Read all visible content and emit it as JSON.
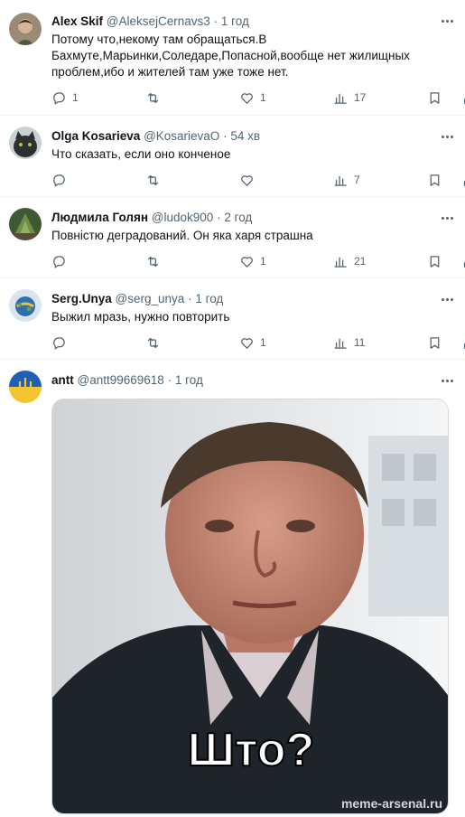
{
  "tweets": [
    {
      "name": "Alex Skif",
      "handle": "@AleksejCernavs3",
      "dot": "·",
      "time": "1 год",
      "text": "Потому что,некому там обращаться.В Бахмуте,Марьинки,Соледаре,Попасной,вообще нет жилищных проблем,ибо и жителей там уже тоже нет.",
      "replies": "1",
      "retweets": "",
      "likes": "1",
      "views": "17"
    },
    {
      "name": "Olga Kosarieva",
      "handle": "@KosarievaO",
      "dot": "·",
      "time": "54 хв",
      "text": "Что сказать, если оно конченое",
      "replies": "",
      "retweets": "",
      "likes": "",
      "views": "7"
    },
    {
      "name": "Людмила Голян",
      "handle": "@ludok900",
      "dot": "·",
      "time": "2 год",
      "text": "Повністю деградований. Он яка харя страшна",
      "replies": "",
      "retweets": "",
      "likes": "1",
      "views": "21"
    },
    {
      "name": "Serg.Unya",
      "handle": "@serg_unya",
      "dot": "·",
      "time": "1 год",
      "text": "Выжил мразь, нужно повторить",
      "replies": "",
      "retweets": "",
      "likes": "1",
      "views": "11"
    },
    {
      "name": "antt",
      "handle": "@antt99669618",
      "dot": "·",
      "time": "1 год"
    }
  ],
  "meme": {
    "caption": "Што?",
    "watermark": "meme-arsenal.ru"
  },
  "colors": {
    "text": "#0f1419",
    "secondary": "#536471",
    "divider": "#eff3f4"
  },
  "icons": [
    "reply-icon",
    "retweet-icon",
    "like-icon",
    "views-icon",
    "bookmark-icon",
    "share-icon",
    "more-icon"
  ]
}
